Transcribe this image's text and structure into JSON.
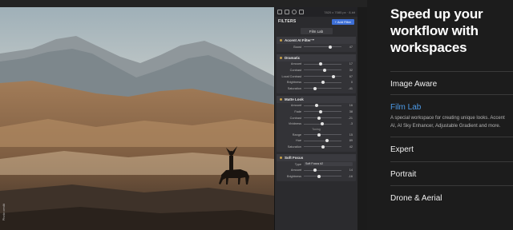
{
  "photo": {
    "credit": "Photo credit"
  },
  "editor": {
    "dimensions": "7820 x 7085 px · 8-bit",
    "filters_label": "FILTERS",
    "add_filter_label": "+ Add Filter",
    "workspace_name": "Film Lab",
    "filters": [
      {
        "name": "Accent AI Filter™",
        "rows": [
          {
            "label": "Boost",
            "value": "47",
            "level": 0.7
          }
        ]
      },
      {
        "name": "Dramatic",
        "rows": [
          {
            "label": "Amount",
            "value": "17",
            "level": 0.45
          },
          {
            "label": "Contrast",
            "value": "32",
            "level": 0.55
          },
          {
            "label": "Local Contrast",
            "value": "67",
            "level": 0.78
          },
          {
            "label": "Brightness",
            "value": "0",
            "level": 0.5
          },
          {
            "label": "Saturation",
            "value": "-41",
            "level": 0.3
          }
        ]
      },
      {
        "name": "Matte Look",
        "rows": [
          {
            "label": "Amount",
            "value": "16",
            "level": 0.35
          },
          {
            "label": "Fade",
            "value": "38",
            "level": 0.45
          },
          {
            "label": "Contrast",
            "value": "-21",
            "level": 0.4
          },
          {
            "label": "Vividness",
            "value": "-3",
            "level": 0.48
          }
        ],
        "toning_label": "Toning",
        "toning_rows": [
          {
            "label": "Range",
            "value": "15",
            "level": 0.4
          },
          {
            "label": "Hue",
            "value": "89",
            "level": 0.62
          },
          {
            "label": "Saturation",
            "value": "42",
            "level": 0.52
          }
        ]
      },
      {
        "name": "Soft Focus",
        "type_label": "Type",
        "type_value": "Soft Focus #2",
        "rows": [
          {
            "label": "Amount",
            "value": "14",
            "level": 0.3
          },
          {
            "label": "Brightness",
            "value": "-16",
            "level": 0.4
          }
        ]
      }
    ]
  },
  "marketing": {
    "headline": "Speed up your workflow with workspaces",
    "items": [
      {
        "title": "Image Aware",
        "active": false
      },
      {
        "title": "Film Lab",
        "active": true,
        "description": "A special workspace for creating unique looks. Accent AI, AI Sky Enhancer, Adjustable Gradient and more."
      },
      {
        "title": "Expert",
        "active": false
      },
      {
        "title": "Portrait",
        "active": false
      },
      {
        "title": "Drone & Aerial",
        "active": false
      }
    ],
    "expand_symbol": "+",
    "accent_color": "#4d9be8"
  }
}
